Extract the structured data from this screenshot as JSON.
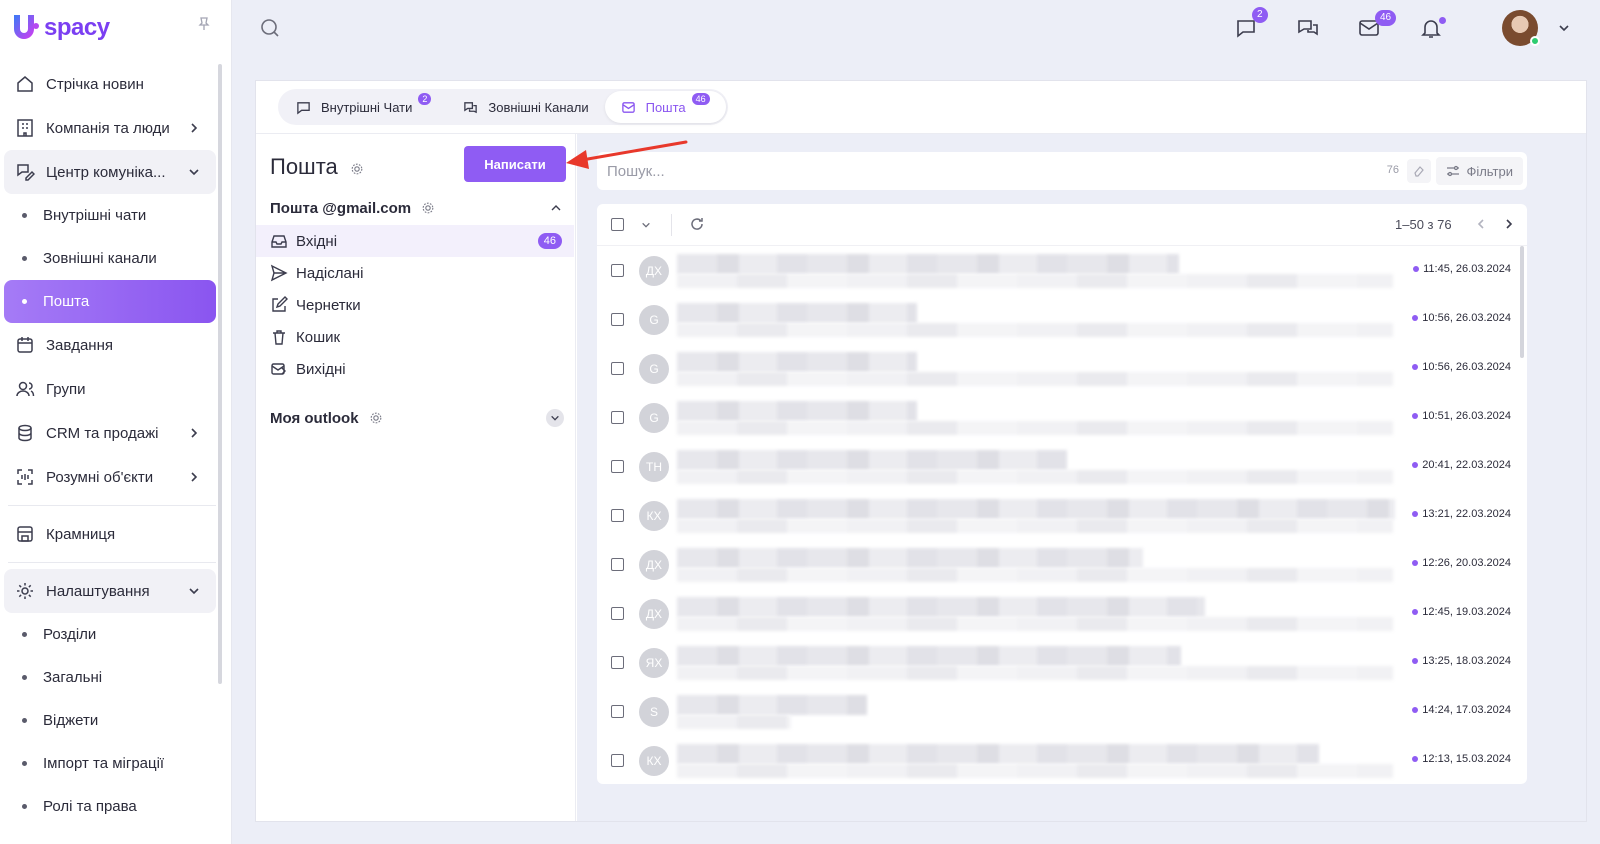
{
  "brand": {
    "name": "spacy"
  },
  "sidebar": {
    "items": [
      {
        "label": "Стрічка новин",
        "icon": "home-icon"
      },
      {
        "label": "Компанія та люди",
        "icon": "building-icon",
        "chevron": true
      },
      {
        "label": "Центр комуніка...",
        "icon": "chat-edit-icon",
        "open": true
      },
      {
        "label": "Внутрішні чати",
        "sub": true
      },
      {
        "label": "Зовнішні канали",
        "sub": true
      },
      {
        "label": "Пошта",
        "sub": true,
        "active": true
      },
      {
        "label": "Завдання",
        "icon": "calendar-icon"
      },
      {
        "label": "Групи",
        "icon": "users-icon"
      },
      {
        "label": "CRM та продажі",
        "icon": "database-icon",
        "chevron": true
      },
      {
        "label": "Розумні об'єкти",
        "icon": "scan-icon",
        "chevron": true
      },
      {
        "label": "Крамниця",
        "icon": "store-icon"
      },
      {
        "label": "Налаштування",
        "icon": "gear-icon",
        "open": true
      },
      {
        "label": "Розділи",
        "sub": true
      },
      {
        "label": "Загальні",
        "sub": true
      },
      {
        "label": "Віджети",
        "sub": true
      },
      {
        "label": "Імпорт та міграції",
        "sub": true
      },
      {
        "label": "Ролі та права",
        "sub": true
      }
    ]
  },
  "topbar": {
    "chat_badge": "2",
    "mail_badge": "46"
  },
  "tabs": [
    {
      "label": "Внутрішні Чати",
      "badge": "2"
    },
    {
      "label": "Зовнішні Канали",
      "badge": ""
    },
    {
      "label": "Пошта",
      "badge": "46"
    }
  ],
  "mail": {
    "title": "Пошта",
    "compose_label": "Написати",
    "account1": "Пошта @gmail.com",
    "account2": "Моя outlook",
    "folders": [
      {
        "label": "Вхідні",
        "badge": "46"
      },
      {
        "label": "Надіслані"
      },
      {
        "label": "Чернетки"
      },
      {
        "label": "Кошик"
      },
      {
        "label": "Вихідні"
      }
    ],
    "search_placeholder": "Пошук...",
    "search_count": "76",
    "filters_label": "Фільтри",
    "pager": "1–50 з 76",
    "messages": [
      {
        "initials": "ДХ",
        "time": "11:45, 26.03.2024"
      },
      {
        "initials": "G",
        "time": "10:56, 26.03.2024"
      },
      {
        "initials": "G",
        "time": "10:56, 26.03.2024"
      },
      {
        "initials": "G",
        "time": "10:51, 26.03.2024"
      },
      {
        "initials": "ТН",
        "time": "20:41, 22.03.2024"
      },
      {
        "initials": "КХ",
        "time": "13:21, 22.03.2024"
      },
      {
        "initials": "ДХ",
        "time": "12:26, 20.03.2024"
      },
      {
        "initials": "ДХ",
        "time": "12:45, 19.03.2024"
      },
      {
        "initials": "ЯХ",
        "time": "13:25, 18.03.2024"
      },
      {
        "initials": "S",
        "time": "14:24, 17.03.2024"
      },
      {
        "initials": "КХ",
        "time": "12:13, 15.03.2024"
      }
    ]
  },
  "colors": {
    "accent": "#8f5cf3",
    "accent_light": "#a57bf6",
    "arrow": "#e8382b"
  }
}
